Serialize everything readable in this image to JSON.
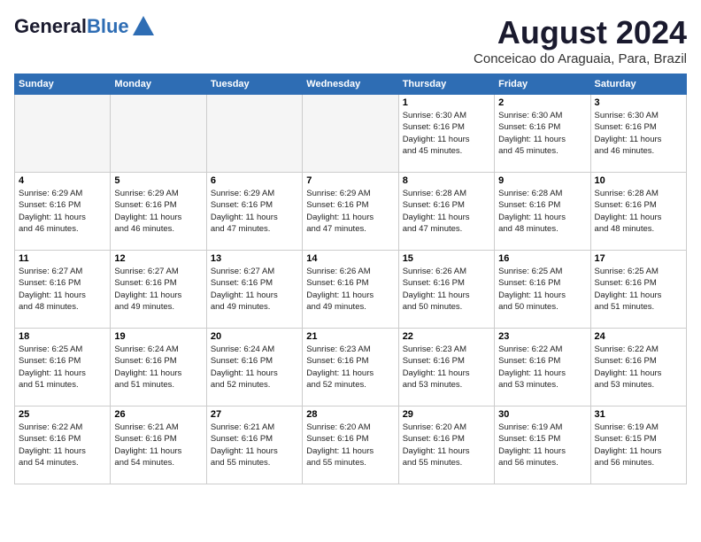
{
  "header": {
    "logo_line1": "General",
    "logo_line2": "Blue",
    "month": "August 2024",
    "location": "Conceicao do Araguaia, Para, Brazil"
  },
  "days_of_week": [
    "Sunday",
    "Monday",
    "Tuesday",
    "Wednesday",
    "Thursday",
    "Friday",
    "Saturday"
  ],
  "weeks": [
    [
      {
        "day": "",
        "info": "",
        "empty": true
      },
      {
        "day": "",
        "info": "",
        "empty": true
      },
      {
        "day": "",
        "info": "",
        "empty": true
      },
      {
        "day": "",
        "info": "",
        "empty": true
      },
      {
        "day": "1",
        "info": "Sunrise: 6:30 AM\nSunset: 6:16 PM\nDaylight: 11 hours\nand 45 minutes.",
        "empty": false
      },
      {
        "day": "2",
        "info": "Sunrise: 6:30 AM\nSunset: 6:16 PM\nDaylight: 11 hours\nand 45 minutes.",
        "empty": false
      },
      {
        "day": "3",
        "info": "Sunrise: 6:30 AM\nSunset: 6:16 PM\nDaylight: 11 hours\nand 46 minutes.",
        "empty": false
      }
    ],
    [
      {
        "day": "4",
        "info": "Sunrise: 6:29 AM\nSunset: 6:16 PM\nDaylight: 11 hours\nand 46 minutes.",
        "empty": false
      },
      {
        "day": "5",
        "info": "Sunrise: 6:29 AM\nSunset: 6:16 PM\nDaylight: 11 hours\nand 46 minutes.",
        "empty": false
      },
      {
        "day": "6",
        "info": "Sunrise: 6:29 AM\nSunset: 6:16 PM\nDaylight: 11 hours\nand 47 minutes.",
        "empty": false
      },
      {
        "day": "7",
        "info": "Sunrise: 6:29 AM\nSunset: 6:16 PM\nDaylight: 11 hours\nand 47 minutes.",
        "empty": false
      },
      {
        "day": "8",
        "info": "Sunrise: 6:28 AM\nSunset: 6:16 PM\nDaylight: 11 hours\nand 47 minutes.",
        "empty": false
      },
      {
        "day": "9",
        "info": "Sunrise: 6:28 AM\nSunset: 6:16 PM\nDaylight: 11 hours\nand 48 minutes.",
        "empty": false
      },
      {
        "day": "10",
        "info": "Sunrise: 6:28 AM\nSunset: 6:16 PM\nDaylight: 11 hours\nand 48 minutes.",
        "empty": false
      }
    ],
    [
      {
        "day": "11",
        "info": "Sunrise: 6:27 AM\nSunset: 6:16 PM\nDaylight: 11 hours\nand 48 minutes.",
        "empty": false
      },
      {
        "day": "12",
        "info": "Sunrise: 6:27 AM\nSunset: 6:16 PM\nDaylight: 11 hours\nand 49 minutes.",
        "empty": false
      },
      {
        "day": "13",
        "info": "Sunrise: 6:27 AM\nSunset: 6:16 PM\nDaylight: 11 hours\nand 49 minutes.",
        "empty": false
      },
      {
        "day": "14",
        "info": "Sunrise: 6:26 AM\nSunset: 6:16 PM\nDaylight: 11 hours\nand 49 minutes.",
        "empty": false
      },
      {
        "day": "15",
        "info": "Sunrise: 6:26 AM\nSunset: 6:16 PM\nDaylight: 11 hours\nand 50 minutes.",
        "empty": false
      },
      {
        "day": "16",
        "info": "Sunrise: 6:25 AM\nSunset: 6:16 PM\nDaylight: 11 hours\nand 50 minutes.",
        "empty": false
      },
      {
        "day": "17",
        "info": "Sunrise: 6:25 AM\nSunset: 6:16 PM\nDaylight: 11 hours\nand 51 minutes.",
        "empty": false
      }
    ],
    [
      {
        "day": "18",
        "info": "Sunrise: 6:25 AM\nSunset: 6:16 PM\nDaylight: 11 hours\nand 51 minutes.",
        "empty": false
      },
      {
        "day": "19",
        "info": "Sunrise: 6:24 AM\nSunset: 6:16 PM\nDaylight: 11 hours\nand 51 minutes.",
        "empty": false
      },
      {
        "day": "20",
        "info": "Sunrise: 6:24 AM\nSunset: 6:16 PM\nDaylight: 11 hours\nand 52 minutes.",
        "empty": false
      },
      {
        "day": "21",
        "info": "Sunrise: 6:23 AM\nSunset: 6:16 PM\nDaylight: 11 hours\nand 52 minutes.",
        "empty": false
      },
      {
        "day": "22",
        "info": "Sunrise: 6:23 AM\nSunset: 6:16 PM\nDaylight: 11 hours\nand 53 minutes.",
        "empty": false
      },
      {
        "day": "23",
        "info": "Sunrise: 6:22 AM\nSunset: 6:16 PM\nDaylight: 11 hours\nand 53 minutes.",
        "empty": false
      },
      {
        "day": "24",
        "info": "Sunrise: 6:22 AM\nSunset: 6:16 PM\nDaylight: 11 hours\nand 53 minutes.",
        "empty": false
      }
    ],
    [
      {
        "day": "25",
        "info": "Sunrise: 6:22 AM\nSunset: 6:16 PM\nDaylight: 11 hours\nand 54 minutes.",
        "empty": false
      },
      {
        "day": "26",
        "info": "Sunrise: 6:21 AM\nSunset: 6:16 PM\nDaylight: 11 hours\nand 54 minutes.",
        "empty": false
      },
      {
        "day": "27",
        "info": "Sunrise: 6:21 AM\nSunset: 6:16 PM\nDaylight: 11 hours\nand 55 minutes.",
        "empty": false
      },
      {
        "day": "28",
        "info": "Sunrise: 6:20 AM\nSunset: 6:16 PM\nDaylight: 11 hours\nand 55 minutes.",
        "empty": false
      },
      {
        "day": "29",
        "info": "Sunrise: 6:20 AM\nSunset: 6:16 PM\nDaylight: 11 hours\nand 55 minutes.",
        "empty": false
      },
      {
        "day": "30",
        "info": "Sunrise: 6:19 AM\nSunset: 6:15 PM\nDaylight: 11 hours\nand 56 minutes.",
        "empty": false
      },
      {
        "day": "31",
        "info": "Sunrise: 6:19 AM\nSunset: 6:15 PM\nDaylight: 11 hours\nand 56 minutes.",
        "empty": false
      }
    ]
  ]
}
